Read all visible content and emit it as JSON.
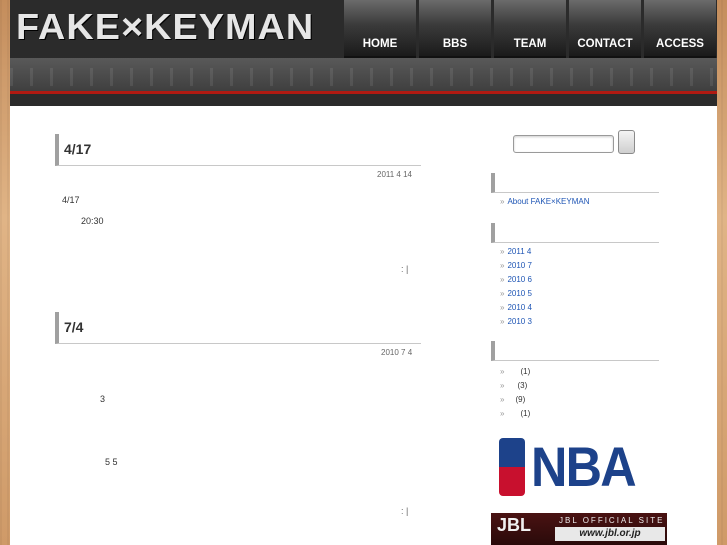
{
  "header": {
    "logo": "FAKE×KEYMAN",
    "nav": [
      "HOME",
      "BBS",
      "TEAM",
      "CONTACT",
      "ACCESS"
    ]
  },
  "posts": [
    {
      "title": "4/17",
      "date": "2011 4 14",
      "lines": [
        "4/17",
        "20:30"
      ],
      "meta": ":   |"
    },
    {
      "title": "7/4",
      "date": "2010 7 4",
      "lines": [
        "3",
        "5 5"
      ],
      "meta": ":   |"
    }
  ],
  "sidebar": {
    "about_link": "About FAKE×KEYMAN",
    "archives": [
      "2011 4",
      "2010 7",
      "2010 6",
      "2010 5",
      "2010 4",
      "2010 3"
    ],
    "categories": [
      "(1)",
      "(3)",
      "(9)",
      "(1)"
    ],
    "bullet": "»",
    "nba_logo": "NBA",
    "jbl": {
      "mark": "JBL",
      "site_label": "JBL OFFICIAL SITE",
      "url": "www.jbl.or.jp"
    }
  },
  "colors": {
    "accent_red": "#b01a12",
    "link_blue": "#1f56b5",
    "nba_blue": "#1d428a",
    "nba_red": "#c8102e"
  }
}
